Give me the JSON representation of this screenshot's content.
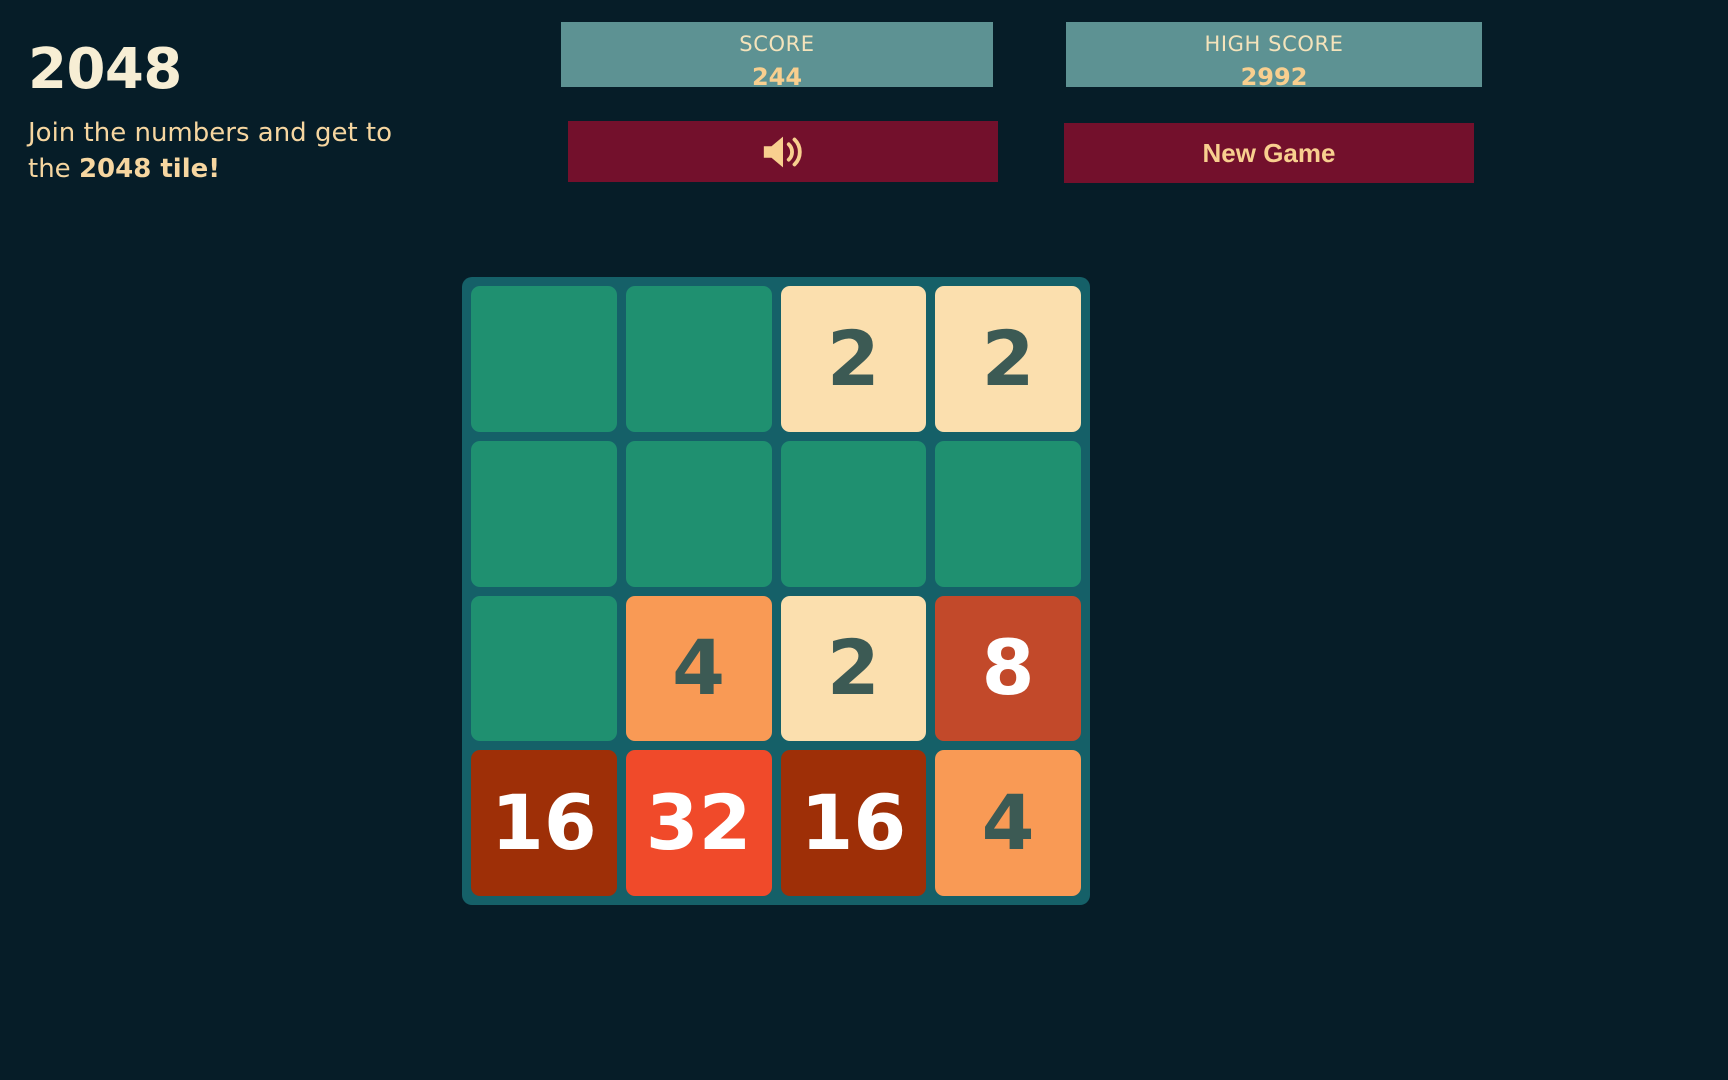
{
  "header": {
    "title": "2048",
    "intro_prefix": "Join the numbers and get to the ",
    "intro_strong": "2048 tile!"
  },
  "scores": {
    "score_label": "SCORE",
    "score_value": "244",
    "high_score_label": "HIGH SCORE",
    "high_score_value": "2992"
  },
  "buttons": {
    "sound_icon": "speaker-on-icon",
    "new_game_label": "New Game"
  },
  "colors": {
    "page_background": "#061d28",
    "board_background": "#156068",
    "empty_cell": "#1f9070",
    "score_box": "#5d9293",
    "button": "#73102c",
    "gold_text": "#f8cf8f",
    "title_text": "#f7eed4",
    "intro_text": "#f6d6a0",
    "tile_dark_text": "#3c5a54",
    "tile_light_text": "#ffffff"
  },
  "board": {
    "rows": 4,
    "cols": 4,
    "tiles": [
      {
        "value": null,
        "bg": "#1f9070",
        "fg": "#3c5a54",
        "size": 0
      },
      {
        "value": null,
        "bg": "#1f9070",
        "fg": "#3c5a54",
        "size": 0
      },
      {
        "value": "2",
        "bg": "#fbdfae",
        "fg": "#3c5a54",
        "size": 76
      },
      {
        "value": "2",
        "bg": "#fbdfae",
        "fg": "#3c5a54",
        "size": 76
      },
      {
        "value": null,
        "bg": "#1f9070",
        "fg": "#3c5a54",
        "size": 0
      },
      {
        "value": null,
        "bg": "#1f9070",
        "fg": "#3c5a54",
        "size": 0
      },
      {
        "value": null,
        "bg": "#1f9070",
        "fg": "#3c5a54",
        "size": 0
      },
      {
        "value": null,
        "bg": "#1f9070",
        "fg": "#3c5a54",
        "size": 0
      },
      {
        "value": null,
        "bg": "#1f9070",
        "fg": "#3c5a54",
        "size": 0
      },
      {
        "value": "4",
        "bg": "#f99a55",
        "fg": "#3c5a54",
        "size": 76
      },
      {
        "value": "2",
        "bg": "#fbdfae",
        "fg": "#3c5a54",
        "size": 76
      },
      {
        "value": "8",
        "bg": "#c2492a",
        "fg": "#ffffff",
        "size": 76
      },
      {
        "value": "16",
        "bg": "#9e2f07",
        "fg": "#ffffff",
        "size": 76
      },
      {
        "value": "32",
        "bg": "#f04a2a",
        "fg": "#ffffff",
        "size": 76
      },
      {
        "value": "16",
        "bg": "#9e2f07",
        "fg": "#ffffff",
        "size": 76
      },
      {
        "value": "4",
        "bg": "#f99a55",
        "fg": "#3c5a54",
        "size": 76
      }
    ]
  }
}
